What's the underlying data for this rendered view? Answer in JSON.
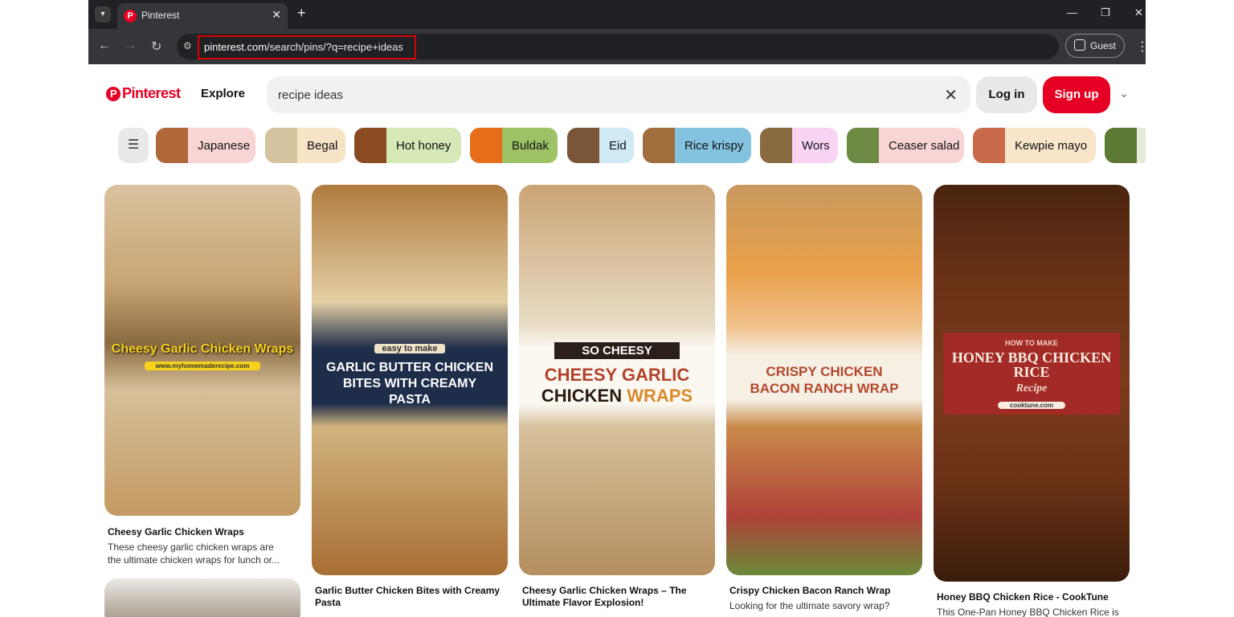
{
  "browser": {
    "tab_title": "Pinterest",
    "url_host": "pinterest.com",
    "url_path": "/search/pins/?q=recipe+ideas",
    "guest_label": "Guest"
  },
  "header": {
    "logo": "Pinterest",
    "explore": "Explore",
    "search_value": "recipe ideas",
    "login": "Log in",
    "signup": "Sign up"
  },
  "chips": [
    {
      "label": "Japanese",
      "color": "#f9d4d4",
      "thumb": "#b0683a"
    },
    {
      "label": "Begal",
      "color": "#f7e3c6",
      "thumb": "#d6c3a0"
    },
    {
      "label": "Hot honey",
      "color": "#d5e8b6",
      "thumb": "#8a4a22"
    },
    {
      "label": "Buldak",
      "color": "#9cc265",
      "thumb": "#e86d1a"
    },
    {
      "label": "Eid",
      "color": "#cfe9f5",
      "thumb": "#7a5538"
    },
    {
      "label": "Rice krispy",
      "color": "#84c3e0",
      "thumb": "#a26d3c"
    },
    {
      "label": "Wors",
      "color": "#f8d3f3",
      "thumb": "#8a6a40"
    },
    {
      "label": "Ceaser salad",
      "color": "#f9d4d4",
      "thumb": "#6d8a42"
    },
    {
      "label": "Kewpie mayo",
      "color": "#f9e6ca",
      "thumb": "#c96b4a"
    }
  ],
  "pins": [
    {
      "title": "Cheesy Garlic Chicken Wraps",
      "desc1": "These cheesy garlic chicken wraps are",
      "desc2": "the ultimate chicken wraps for lunch or...",
      "overlay": "Cheesy Garlic Chicken Wraps",
      "overlay_sub": "www.myhomemaderecipe.com"
    },
    {
      "title1": "Garlic Butter Chicken Bites with Creamy",
      "title2": "Pasta",
      "overlay_tag": "easy to make",
      "overlay1": "GARLIC BUTTER CHICKEN",
      "overlay2": "BITES WITH CREAMY",
      "overlay3": "PASTA"
    },
    {
      "title1": "Cheesy Garlic Chicken Wraps – The",
      "title2": "Ultimate Flavor Explosion!",
      "overlay_tag": "SO CHEESY",
      "overlay1": "CHEESY GARLIC",
      "overlay2a": "CHICKEN ",
      "overlay2b": "WRAPS"
    },
    {
      "title": "Crispy Chicken Bacon Ranch Wrap",
      "desc1": "Looking for the ultimate savory wrap?",
      "overlay1": "CRISPY CHICKEN",
      "overlay2": "BACON RANCH WRAP"
    },
    {
      "title": "Honey BBQ Chicken Rice - CookTune",
      "desc1": "This One-Pan Honey BBQ Chicken Rice is",
      "overlay_top": "HOW TO MAKE",
      "overlay1": "HONEY BBQ CHICKEN",
      "overlay2": "RICE",
      "overlay_script": "Recipe",
      "overlay_site": "cooktune.com"
    }
  ]
}
